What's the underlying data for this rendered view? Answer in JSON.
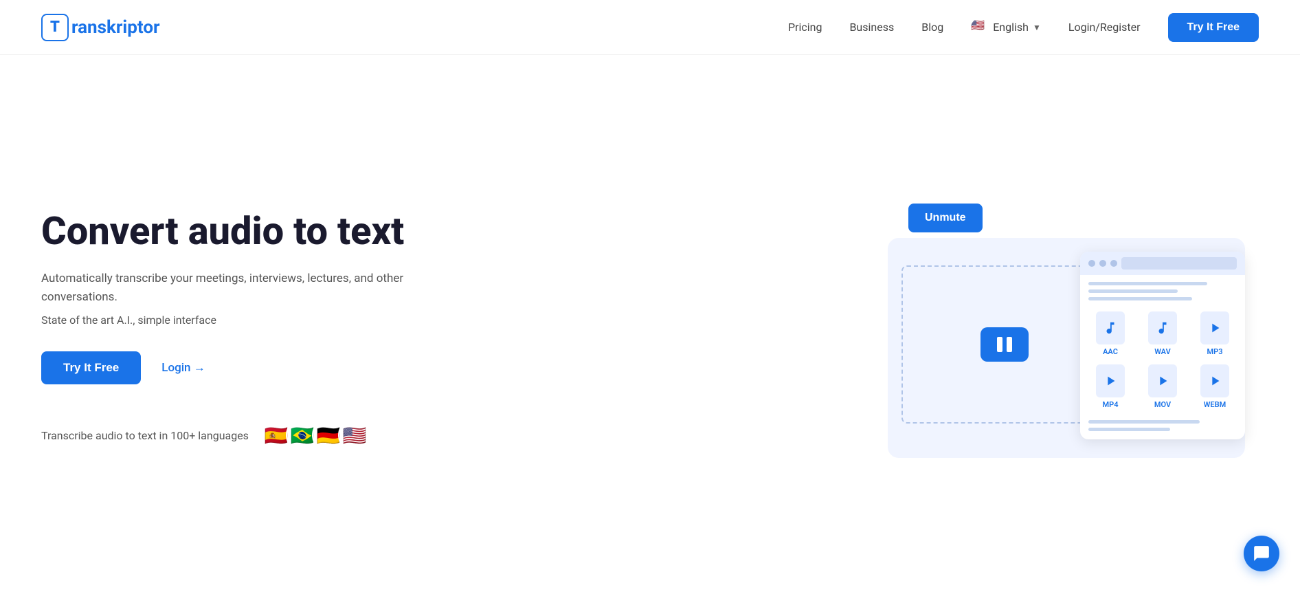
{
  "navbar": {
    "logo_letter": "T",
    "logo_text": "ranskriptor",
    "nav_items": [
      {
        "label": "Pricing",
        "id": "pricing"
      },
      {
        "label": "Business",
        "id": "business"
      },
      {
        "label": "Blog",
        "id": "blog"
      }
    ],
    "language": "English",
    "login_register": "Login/Register",
    "try_btn": "Try It Free"
  },
  "hero": {
    "title": "Convert audio to text",
    "subtitle": "Automatically transcribe your meetings, interviews, lectures, and other conversations.",
    "state_of_art": "State of the art A.I., simple interface",
    "try_btn": "Try It Free",
    "login_link": "Login →",
    "languages_text": "Transcribe audio to text in 100+ languages",
    "flags": [
      "🇪🇸",
      "🇧🇷",
      "🇩🇪",
      "🇺🇸"
    ]
  },
  "illustration": {
    "unmute_btn": "Unmute",
    "file_formats": [
      {
        "label": "AAC"
      },
      {
        "label": "WAV"
      },
      {
        "label": "MP3"
      },
      {
        "label": "MP4"
      },
      {
        "label": "MOV"
      },
      {
        "label": "WEBM"
      }
    ]
  },
  "chat_icon": "chat-icon"
}
